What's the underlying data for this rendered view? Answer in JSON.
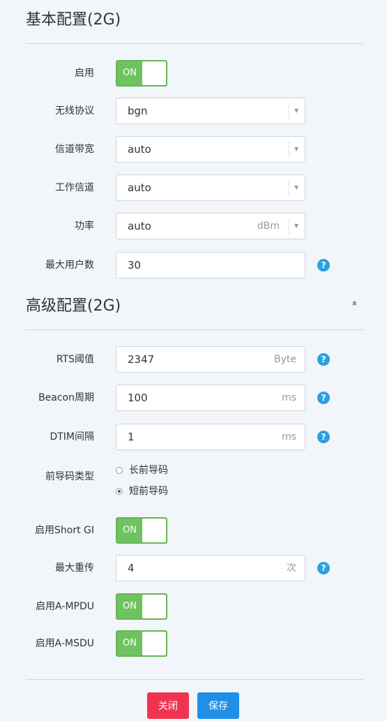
{
  "basic": {
    "title": "基本配置(2G)",
    "enable_label": "启用",
    "enable_toggle": "ON",
    "protocol_label": "无线协议",
    "protocol_value": "bgn",
    "bandwidth_label": "信道带宽",
    "bandwidth_value": "auto",
    "channel_label": "工作信道",
    "channel_value": "auto",
    "power_label": "功率",
    "power_value": "auto",
    "power_unit": "dBm",
    "max_users_label": "最大用户数",
    "max_users_value": "30"
  },
  "advanced": {
    "title": "高级配置(2G)",
    "collapse_icon": "«",
    "rts_label": "RTS阈值",
    "rts_value": "2347",
    "rts_unit": "Byte",
    "beacon_label": "Beacon周期",
    "beacon_value": "100",
    "beacon_unit": "ms",
    "dtim_label": "DTIM间隔",
    "dtim_value": "1",
    "dtim_unit": "ms",
    "preamble_label": "前导码类型",
    "preamble_long": "长前导码",
    "preamble_short": "短前导码",
    "preamble_selected": "短前导码",
    "short_gi_label": "启用Short GI",
    "short_gi_toggle": "ON",
    "max_retry_label": "最大重传",
    "max_retry_value": "4",
    "max_retry_unit": "次",
    "ampdu_label": "启用A-MPDU",
    "ampdu_toggle": "ON",
    "amsdu_label": "启用A-MSDU",
    "amsdu_toggle": "ON"
  },
  "help_icon_text": "?",
  "dropdown_caret": "▼",
  "buttons": {
    "close": "关闭",
    "save": "保存"
  },
  "colors": {
    "toggle_on": "#6ec25f",
    "help": "#2d9fe3",
    "close_button": "#f0344f",
    "save_button": "#1f8fe8",
    "background": "#f2f6fb"
  }
}
